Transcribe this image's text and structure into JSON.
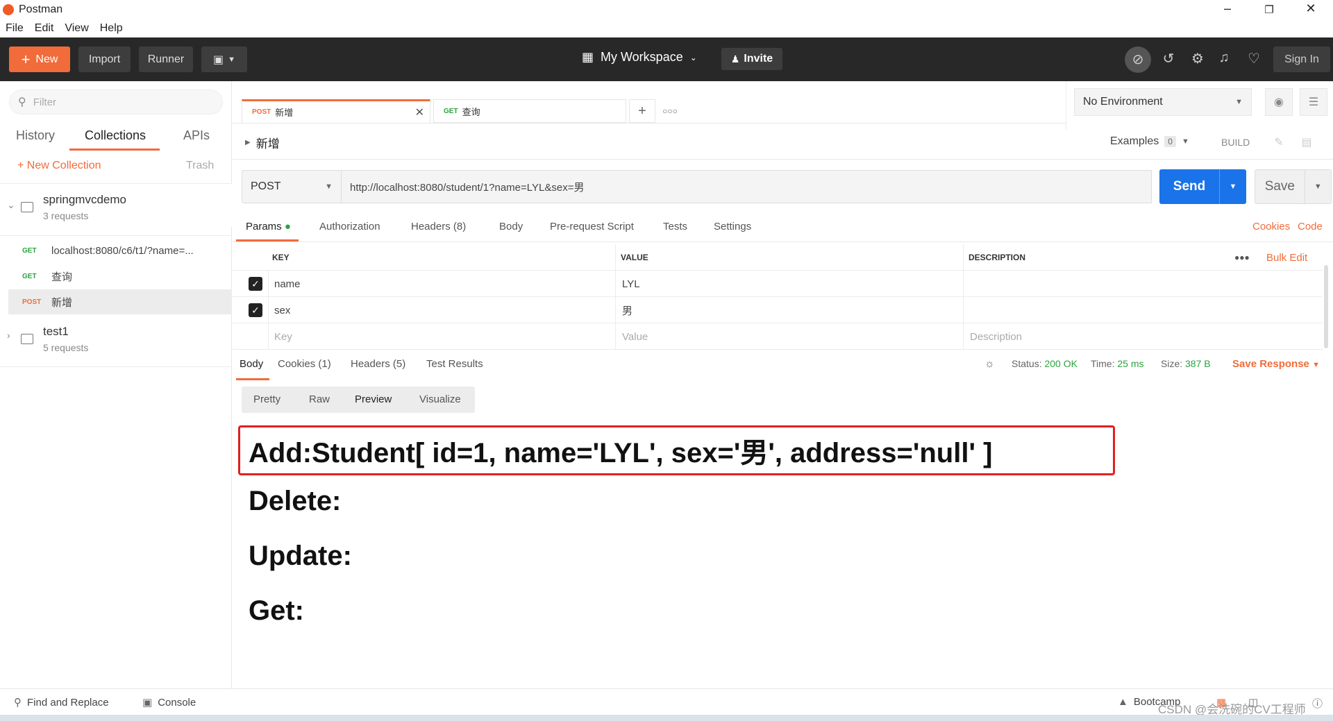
{
  "app": {
    "title": "Postman"
  },
  "menu": [
    "File",
    "Edit",
    "View",
    "Help"
  ],
  "toolbar": {
    "new_label": "New",
    "import_label": "Import",
    "runner_label": "Runner",
    "workspace_label": "My Workspace",
    "invite_label": "Invite",
    "signin_label": "Sign In"
  },
  "sidebar": {
    "filter_placeholder": "Filter",
    "tabs": [
      "History",
      "Collections",
      "APIs"
    ],
    "active_tab": "Collections",
    "new_collection_label": "New Collection",
    "trash_label": "Trash",
    "collections": [
      {
        "name": "springmvcdemo",
        "count": "3 requests",
        "requests": [
          {
            "method": "GET",
            "title": "localhost:8080/c6/t1/?name=..."
          },
          {
            "method": "GET",
            "title": "查询"
          },
          {
            "method": "POST",
            "title": "新增"
          }
        ]
      },
      {
        "name": "test1",
        "count": "5 requests"
      }
    ]
  },
  "tabs": [
    {
      "method": "POST",
      "title": "新增"
    },
    {
      "method": "GET",
      "title": "查询"
    }
  ],
  "environment": {
    "selected": "No Environment"
  },
  "request": {
    "name": "新增",
    "examples_label": "Examples",
    "examples_count": "0",
    "build_label": "BUILD",
    "method": "POST",
    "url": "http://localhost:8080/student/1?name=LYL&sex=男",
    "send_label": "Send",
    "save_label": "Save",
    "tabs": [
      "Params",
      "Authorization",
      "Headers (8)",
      "Body",
      "Pre-request Script",
      "Tests",
      "Settings"
    ],
    "cookies_label": "Cookies",
    "code_label": "Code"
  },
  "params": {
    "headers": [
      "KEY",
      "VALUE",
      "DESCRIPTION"
    ],
    "bulk_edit_label": "Bulk Edit",
    "rows": [
      {
        "key": "name",
        "value": "LYL",
        "description": ""
      },
      {
        "key": "sex",
        "value": "男",
        "description": ""
      }
    ],
    "placeholder": {
      "key": "Key",
      "value": "Value",
      "description": "Description"
    }
  },
  "response": {
    "tabs": [
      "Body",
      "Cookies (1)",
      "Headers (5)",
      "Test Results"
    ],
    "status_label": "Status:",
    "status_value": "200 OK",
    "time_label": "Time:",
    "time_value": "25 ms",
    "size_label": "Size:",
    "size_value": "387 B",
    "save_response_label": "Save Response",
    "view_modes": [
      "Pretty",
      "Raw",
      "Preview",
      "Visualize"
    ],
    "active_view": "Preview",
    "lines": [
      "Add:Student[ id=1, name='LYL', sex='男', address='null' ]",
      "Delete:",
      "Update:",
      "Get:"
    ]
  },
  "bottom": {
    "find_replace_label": "Find and Replace",
    "console_label": "Console",
    "bootcamp_label": "Bootcamp"
  },
  "watermark": "CSDN @会洗碗的CV工程师",
  "colors": {
    "accent": "#f26b3a",
    "send": "#1a73e8",
    "ok": "#2aa33e",
    "highlight": "#e02020"
  }
}
